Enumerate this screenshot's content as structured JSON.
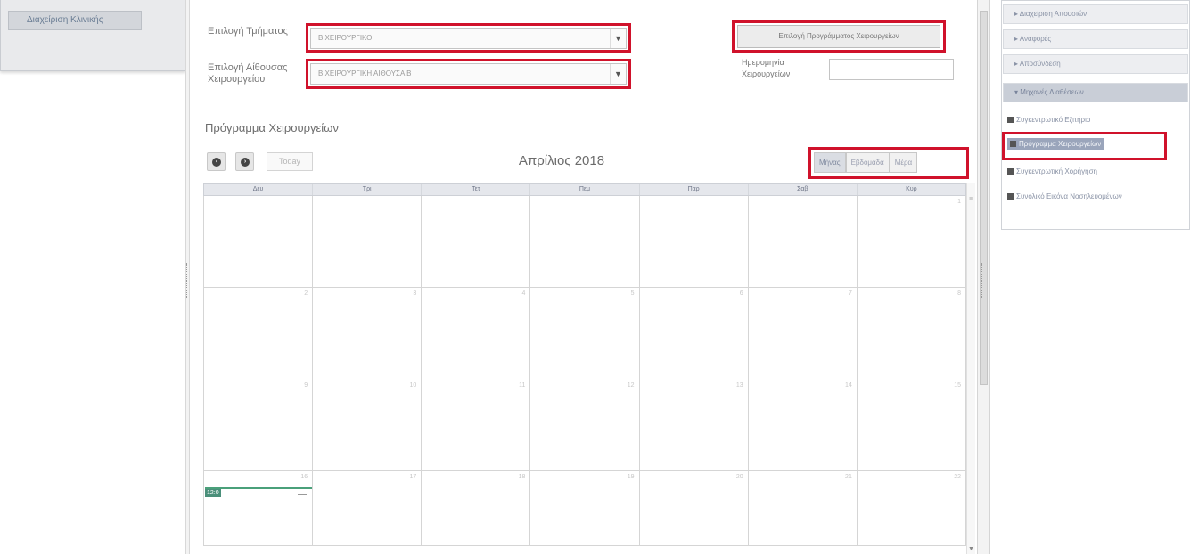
{
  "left_panel": {
    "item_label": "Διαχείριση Κλινικής"
  },
  "filters": {
    "department_label": "Επιλογή Τμήματος",
    "department_value": "Β ΧΕΙΡΟΥΡΓΙΚΟ",
    "room_label_line1": "Επιλογή Αίθουσας",
    "room_label_line2": "Χειρουργείου",
    "room_value": "Β ΧΕΙΡΟΥΡΓΙΚΗ ΑΙΘΟΥΣΑ Β",
    "load_button": "Επιλογή Προγράμματος Χειρουργείων",
    "date_label_line1": "Ημερομηνία",
    "date_label_line2": "Χειρουργείων",
    "date_value": ""
  },
  "calendar": {
    "section_title": "Πρόγραμμα Χειρουργείων",
    "prev_icon": "chevron-left-icon",
    "next_icon": "chevron-right-icon",
    "today_label": "Today",
    "month_title": "Απρίλιος 2018",
    "views": [
      "Μήνας",
      "Εβδομάδα",
      "Μέρα"
    ],
    "active_view": "Μήνας",
    "weekdays": [
      "Δευ",
      "Τρι",
      "Τετ",
      "Πεμ",
      "Παρ",
      "Σαβ",
      "Κυρ"
    ],
    "weeks": [
      [
        "",
        "",
        "",
        "",
        "",
        "",
        "1"
      ],
      [
        "2",
        "3",
        "4",
        "5",
        "6",
        "7",
        "8"
      ],
      [
        "9",
        "10",
        "11",
        "12",
        "13",
        "14",
        "15"
      ],
      [
        "16",
        "17",
        "18",
        "19",
        "20",
        "21",
        "22"
      ]
    ],
    "event": {
      "day": "16",
      "label": "12:0"
    }
  },
  "right_panel": {
    "sections": [
      "Διαχείριση Απουσιών",
      "Αναφορές",
      "Αποσύνδεση",
      "Μηχανές Διαθέσεων"
    ],
    "active_section": "Μηχανές Διαθέσεων",
    "menu_items": [
      "Συγκεντρωτικό Εξιτήριο",
      "Πρόγραμμα Χειρουργείων",
      "Συγκεντρωτική Χορήγηση",
      "Συνολικό Εικόνα Νοσηλευομένων"
    ],
    "selected_item": "Πρόγραμμα Χειρουργείων"
  },
  "colors": {
    "highlight": "#d0122b",
    "event": "#4a8f7a"
  }
}
